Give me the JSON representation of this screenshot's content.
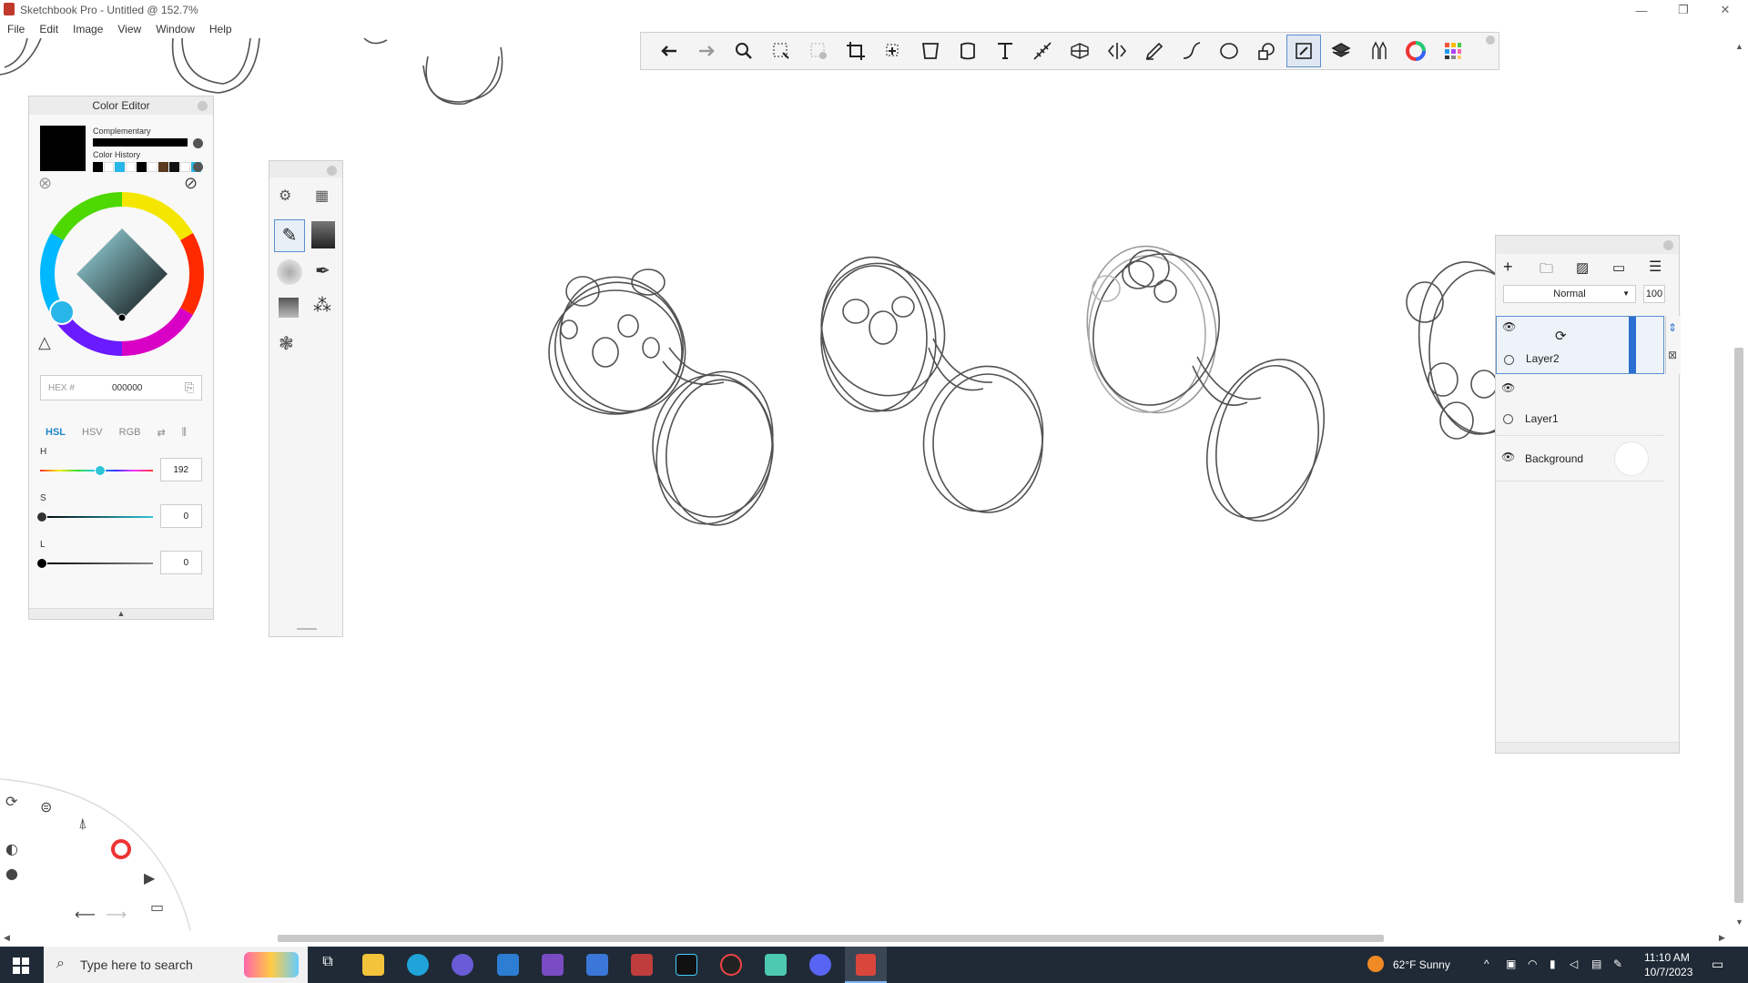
{
  "window": {
    "title": "Sketchbook Pro - Untitled @ 152.7%"
  },
  "menu": [
    "File",
    "Edit",
    "Image",
    "View",
    "Window",
    "Help"
  ],
  "toolbar": {
    "tools": [
      "undo-icon",
      "redo-icon",
      "zoom-icon",
      "select-icon",
      "lasso-select-icon",
      "crop-icon",
      "transform-icon",
      "distort-icon",
      "warp-icon",
      "text-icon",
      "ruler-icon",
      "perspective-icon",
      "symmetry-icon",
      "pen-icon",
      "curve-icon",
      "ellipse-icon",
      "shapes-icon",
      "brush-library-icon",
      "layers-icon",
      "copic-icon",
      "color-wheel-icon",
      "swatches-icon"
    ]
  },
  "color_editor": {
    "title": "Color Editor",
    "complementary_label": "Complementary",
    "history_label": "Color History",
    "history_colors": [
      "#000000",
      "#ffffff",
      "#29b6e8",
      "#ffffff",
      "#000000",
      "#ffffff",
      "#5a3a1e",
      "#111111",
      "#ffffff",
      "#29b6e8",
      "#000000"
    ],
    "current_color": "#000000",
    "hex_label": "HEX #",
    "hex_value": "000000",
    "modes": [
      "HSL",
      "HSV",
      "RGB"
    ],
    "active_mode": "HSL",
    "h_label": "H",
    "h_value": "192",
    "s_label": "S",
    "s_value": "0",
    "l_label": "L",
    "l_value": "0"
  },
  "layers": {
    "blend_mode": "Normal",
    "opacity": "100",
    "items": [
      {
        "name": "Layer2",
        "selected": true
      },
      {
        "name": "Layer1",
        "selected": false
      },
      {
        "name": "Background",
        "selected": false
      }
    ]
  },
  "taskbar": {
    "search_placeholder": "Type here to search",
    "weather": "62°F  Sunny",
    "time": "11:10 AM",
    "date": "10/7/2023"
  }
}
